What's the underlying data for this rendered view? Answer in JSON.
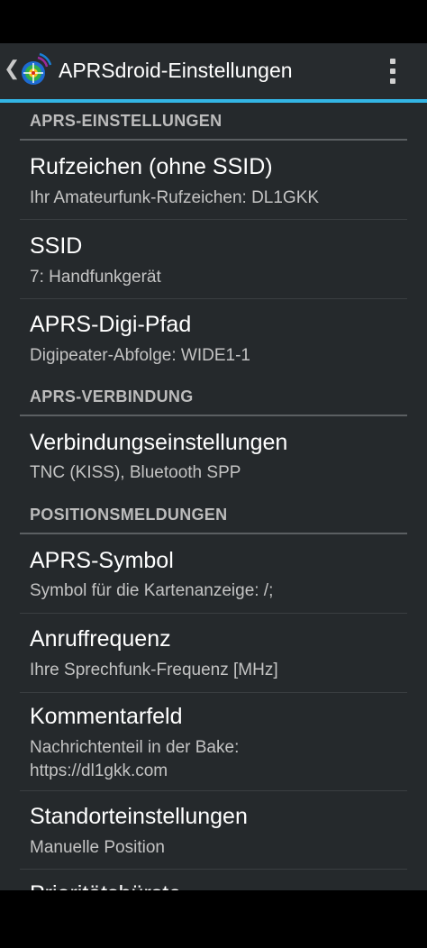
{
  "app_bar": {
    "title": "APRSdroid-Einstellungen",
    "up_icon": "chevron-left-icon",
    "app_icon": "aprsdroid-logo",
    "menu_icon": "overflow-menu-icon"
  },
  "colors": {
    "accent": "#33b5e5",
    "background": "#25292c",
    "action_bar": "#272b2e"
  },
  "sections": {
    "aprs_settings": "APRS-EINSTELLUNGEN",
    "aprs_connection": "APRS-VERBINDUNG",
    "position_reports": "POSITIONSMELDUNGEN"
  },
  "prefs": {
    "callsign": {
      "title": "Rufzeichen (ohne SSID)",
      "summary": "Ihr Amateurfunk-Rufzeichen: DL1GKK"
    },
    "ssid": {
      "title": "SSID",
      "summary": "7: Handfunkgerät"
    },
    "digi_path": {
      "title": "APRS-Digi-Pfad",
      "summary": "Digipeater-Abfolge: WIDE1-1"
    },
    "connection": {
      "title": "Verbindungseinstellungen",
      "summary": "TNC (KISS), Bluetooth SPP"
    },
    "symbol": {
      "title": "APRS-Symbol",
      "summary": "Symbol für die Kartenanzeige: /;"
    },
    "frequency": {
      "title": "Anruffrequenz",
      "summary": "Ihre Sprechfunk-Frequenz [MHz]"
    },
    "comment": {
      "title": "Kommentarfeld",
      "summary_line1": "Nachrichtenteil in der Bake:",
      "summary_line2": "https://dl1gkk.com"
    },
    "location": {
      "title": "Standorteinstellungen",
      "summary": "Manuelle Position"
    },
    "partial": {
      "title": "Prioritätsbürste"
    }
  }
}
